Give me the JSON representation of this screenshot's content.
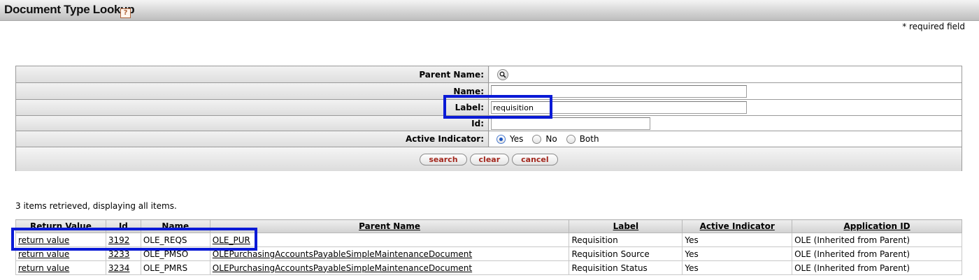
{
  "header": {
    "title": "Document Type Lookup",
    "help_icon": "?",
    "required_note": "* required field"
  },
  "form": {
    "parent_name": {
      "label": "Parent Name:",
      "icon": "magnifier-icon"
    },
    "name": {
      "label": "Name:",
      "value": ""
    },
    "label_field": {
      "label": "Label:",
      "value": "requisition"
    },
    "id": {
      "label": "Id:",
      "value": ""
    },
    "active_indicator": {
      "label": "Active Indicator:",
      "options": [
        "Yes",
        "No",
        "Both"
      ],
      "selected": "Yes"
    },
    "buttons": {
      "search": "search",
      "clear": "clear",
      "cancel": "cancel"
    }
  },
  "results": {
    "count_text": "3 items retrieved, displaying all items.",
    "columns": [
      "Return Value",
      "Id",
      "Name",
      "Parent Name",
      "Label",
      "Active Indicator",
      "Application ID"
    ],
    "rows": [
      {
        "return_value": "return value",
        "id": "3192",
        "name": "OLE_REQS",
        "parent_name": "OLE_PUR",
        "label": "Requisition",
        "active": "Yes",
        "app_id": "OLE (Inherited from Parent)"
      },
      {
        "return_value": "return value",
        "id": "3233",
        "name": "OLE_PMSO",
        "parent_name": "OLEPurchasingAccountsPayableSimpleMaintenanceDocument",
        "label": "Requisition Source",
        "active": "Yes",
        "app_id": "OLE (Inherited from Parent)"
      },
      {
        "return_value": "return value",
        "id": "3234",
        "name": "OLE_PMRS",
        "parent_name": "OLEPurchasingAccountsPayableSimpleMaintenanceDocument",
        "label": "Requisition Status",
        "active": "Yes",
        "app_id": "OLE (Inherited from Parent)"
      }
    ]
  },
  "colors": {
    "highlight": "#0a1ad6",
    "button_text": "#a3281e"
  }
}
